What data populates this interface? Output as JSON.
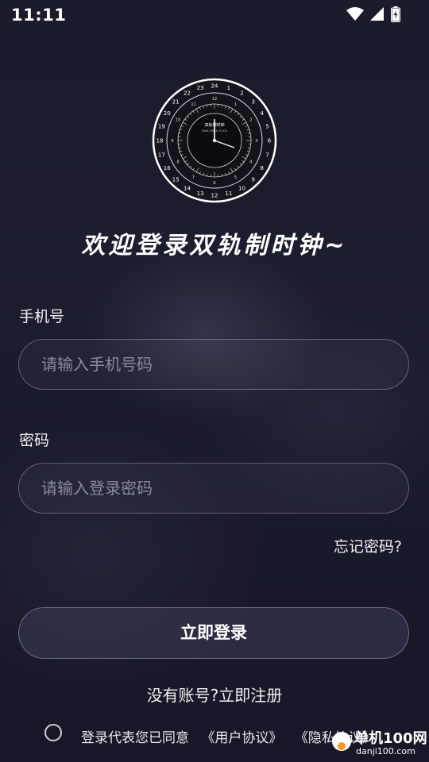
{
  "status_bar": {
    "time": "11:11"
  },
  "logo": {
    "name": "clock-dial-logo",
    "center_text_top": "双轨制时钟",
    "center_text_bottom": "DUAL-TRACK CLOCK"
  },
  "welcome_title": "欢迎登录双轨制时钟~",
  "phone": {
    "label": "手机号",
    "placeholder": "请输入手机号码",
    "value": ""
  },
  "password": {
    "label": "密码",
    "placeholder": "请输入登录密码",
    "value": ""
  },
  "forgot_password": "忘记密码?",
  "login_button": "立即登录",
  "register_prompt": "没有账号?立即注册",
  "agreement": {
    "checked": false,
    "prefix": "登录代表您已同意",
    "user_agreement": "《用户协议》",
    "privacy_policy": "《隐私协议》"
  },
  "watermark": {
    "title": "单机100网",
    "url": "danji100.com"
  }
}
